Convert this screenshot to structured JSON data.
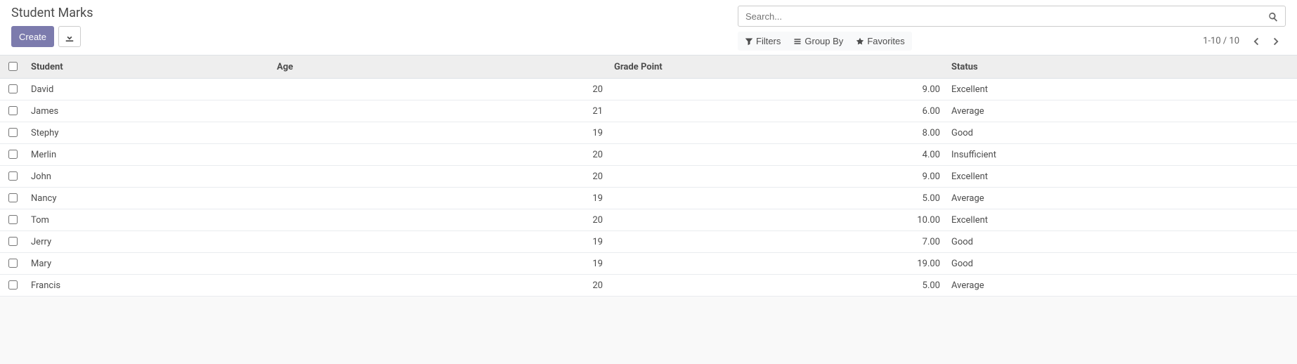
{
  "header": {
    "title": "Student Marks",
    "create_label": "Create"
  },
  "search": {
    "placeholder": "Search...",
    "filters_label": "Filters",
    "groupby_label": "Group By",
    "favorites_label": "Favorites"
  },
  "pager": {
    "range": "1-10 / 10"
  },
  "table": {
    "columns": {
      "student": "Student",
      "age": "Age",
      "grade_point": "Grade Point",
      "status": "Status"
    },
    "rows": [
      {
        "student": "David",
        "age": "20",
        "grade_point": "9.00",
        "status": "Excellent"
      },
      {
        "student": "James",
        "age": "21",
        "grade_point": "6.00",
        "status": "Average"
      },
      {
        "student": "Stephy",
        "age": "19",
        "grade_point": "8.00",
        "status": "Good"
      },
      {
        "student": "Merlin",
        "age": "20",
        "grade_point": "4.00",
        "status": "Insufficient"
      },
      {
        "student": "John",
        "age": "20",
        "grade_point": "9.00",
        "status": "Excellent"
      },
      {
        "student": "Nancy",
        "age": "19",
        "grade_point": "5.00",
        "status": "Average"
      },
      {
        "student": "Tom",
        "age": "20",
        "grade_point": "10.00",
        "status": "Excellent"
      },
      {
        "student": "Jerry",
        "age": "19",
        "grade_point": "7.00",
        "status": "Good"
      },
      {
        "student": "Mary",
        "age": "19",
        "grade_point": "19.00",
        "status": "Good"
      },
      {
        "student": "Francis",
        "age": "20",
        "grade_point": "5.00",
        "status": "Average"
      }
    ]
  }
}
